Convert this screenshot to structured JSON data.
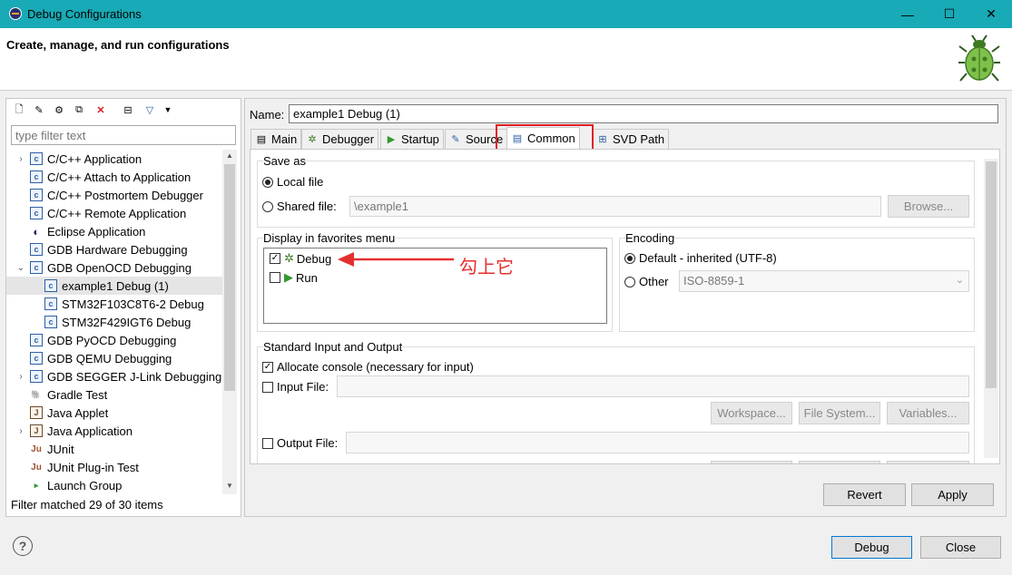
{
  "window": {
    "title": "Debug Configurations",
    "minimize": "—",
    "maximize": "☐",
    "close": "✕"
  },
  "header": {
    "title": "Create, manage, and run configurations"
  },
  "left": {
    "filter_placeholder": "type filter text",
    "tree": [
      {
        "label": "C/C++ Application",
        "expand": "›",
        "icon": "c-config-icon",
        "glyph": "c",
        "level": 0
      },
      {
        "label": "C/C++ Attach to Application",
        "expand": "",
        "icon": "c-config-icon",
        "glyph": "c",
        "level": 0
      },
      {
        "label": "C/C++ Postmortem Debugger",
        "expand": "",
        "icon": "c-config-icon",
        "glyph": "c",
        "level": 0
      },
      {
        "label": "C/C++ Remote Application",
        "expand": "",
        "icon": "c-config-icon",
        "glyph": "c",
        "level": 0
      },
      {
        "label": "Eclipse Application",
        "expand": "",
        "icon": "eclipse-icon",
        "glyph": "◐",
        "level": 0
      },
      {
        "label": "GDB Hardware Debugging",
        "expand": "",
        "icon": "c-config-icon",
        "glyph": "c",
        "level": 0
      },
      {
        "label": "GDB OpenOCD Debugging",
        "expand": "⌄",
        "icon": "c-config-icon",
        "glyph": "c",
        "level": 0
      },
      {
        "label": "example1 Debug (1)",
        "expand": "",
        "icon": "c-config-icon",
        "glyph": "c",
        "level": 1,
        "selected": true
      },
      {
        "label": "STM32F103C8T6-2 Debug",
        "expand": "",
        "icon": "c-config-icon",
        "glyph": "c",
        "level": 1
      },
      {
        "label": "STM32F429IGT6 Debug",
        "expand": "",
        "icon": "c-config-icon",
        "glyph": "c",
        "level": 1
      },
      {
        "label": "GDB PyOCD Debugging",
        "expand": "",
        "icon": "c-config-icon",
        "glyph": "c",
        "level": 0
      },
      {
        "label": "GDB QEMU Debugging",
        "expand": "",
        "icon": "c-config-icon",
        "glyph": "c",
        "level": 0
      },
      {
        "label": "GDB SEGGER J-Link Debugging",
        "expand": "›",
        "icon": "c-config-icon",
        "glyph": "c",
        "level": 0
      },
      {
        "label": "Gradle Test",
        "expand": "",
        "icon": "gradle-icon",
        "glyph": "🐘",
        "level": 0
      },
      {
        "label": "Java Applet",
        "expand": "",
        "icon": "java-applet-icon",
        "glyph": "J",
        "level": 0
      },
      {
        "label": "Java Application",
        "expand": "›",
        "icon": "java-app-icon",
        "glyph": "J",
        "level": 0
      },
      {
        "label": "JUnit",
        "expand": "",
        "icon": "junit-icon",
        "glyph": "Ju",
        "level": 0
      },
      {
        "label": "JUnit Plug-in Test",
        "expand": "",
        "icon": "junit-icon",
        "glyph": "Ju",
        "level": 0
      },
      {
        "label": "Launch Group",
        "expand": "",
        "icon": "launch-group-icon",
        "glyph": "▸",
        "level": 0
      }
    ],
    "status": "Filter matched 29 of 30 items"
  },
  "right": {
    "name_label": "Name:",
    "name_value": "example1 Debug (1)",
    "tabs": [
      {
        "label": "Main",
        "icon": "main-tab-icon",
        "glyph": "▤"
      },
      {
        "label": "Debugger",
        "icon": "debugger-bug-icon",
        "glyph": "✲"
      },
      {
        "label": "Startup",
        "icon": "startup-play-icon",
        "glyph": "▶"
      },
      {
        "label": "Source",
        "icon": "source-icon",
        "glyph": "✎"
      },
      {
        "label": "Common",
        "icon": "common-tab-icon",
        "glyph": "▤"
      },
      {
        "label": "SVD Path",
        "icon": "svd-tree-icon",
        "glyph": "⊞"
      }
    ],
    "common": {
      "save_as": "Save as",
      "local_file": "Local file",
      "shared_file": "Shared file:",
      "shared_value": "\\example1",
      "browse": "Browse...",
      "favorites": "Display in favorites menu",
      "fav_debug": "Debug",
      "fav_run": "Run",
      "annotation": "勾上它",
      "encoding": "Encoding",
      "enc_default": "Default - inherited (UTF-8)",
      "enc_other": "Other",
      "enc_value": "ISO-8859-1",
      "std_io": "Standard Input and Output",
      "allocate_console": "Allocate console (necessary for input)",
      "input_file": "Input File:",
      "workspace": "Workspace...",
      "file_system": "File System...",
      "variables": "Variables...",
      "output_file": "Output File:"
    },
    "revert": "Revert",
    "apply": "Apply"
  },
  "footer": {
    "debug": "Debug",
    "close": "Close",
    "help": "?"
  }
}
